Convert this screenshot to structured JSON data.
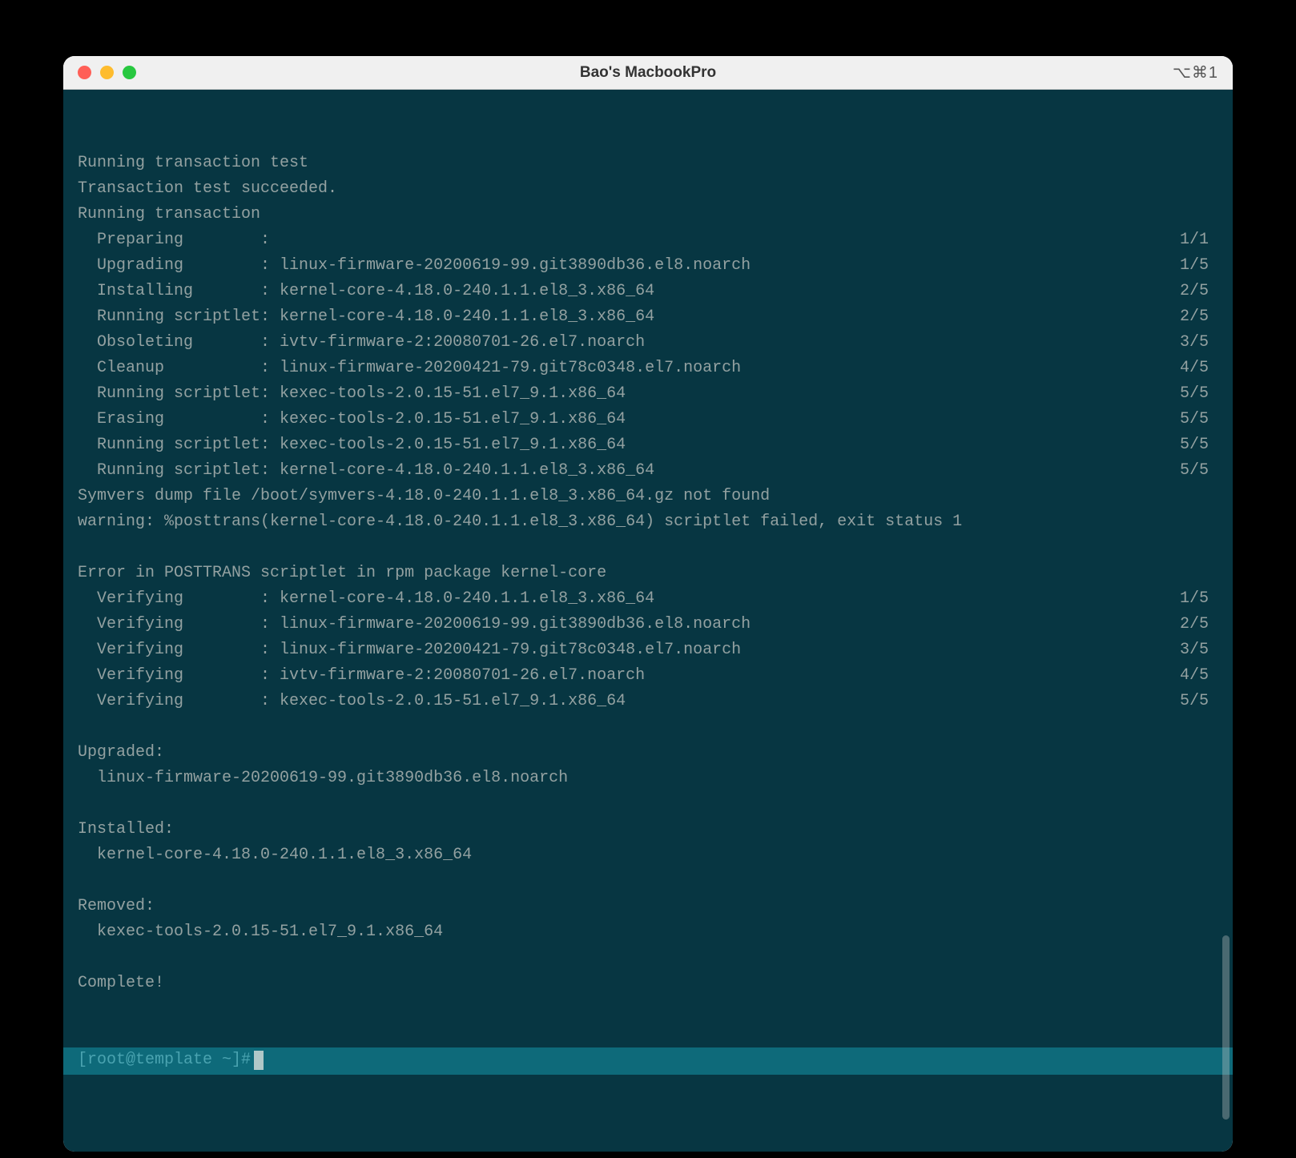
{
  "window": {
    "title": "Bao's MacbookPro",
    "shortcut": "⌥⌘1"
  },
  "terminal": {
    "lines": [
      {
        "left": "Running transaction test",
        "right": ""
      },
      {
        "left": "Transaction test succeeded.",
        "right": ""
      },
      {
        "left": "Running transaction",
        "right": ""
      },
      {
        "left": "  Preparing        :",
        "right": "1/1"
      },
      {
        "left": "  Upgrading        : linux-firmware-20200619-99.git3890db36.el8.noarch",
        "right": "1/5"
      },
      {
        "left": "  Installing       : kernel-core-4.18.0-240.1.1.el8_3.x86_64",
        "right": "2/5"
      },
      {
        "left": "  Running scriptlet: kernel-core-4.18.0-240.1.1.el8_3.x86_64",
        "right": "2/5"
      },
      {
        "left": "  Obsoleting       : ivtv-firmware-2:20080701-26.el7.noarch",
        "right": "3/5"
      },
      {
        "left": "  Cleanup          : linux-firmware-20200421-79.git78c0348.el7.noarch",
        "right": "4/5"
      },
      {
        "left": "  Running scriptlet: kexec-tools-2.0.15-51.el7_9.1.x86_64",
        "right": "5/5"
      },
      {
        "left": "  Erasing          : kexec-tools-2.0.15-51.el7_9.1.x86_64",
        "right": "5/5"
      },
      {
        "left": "  Running scriptlet: kexec-tools-2.0.15-51.el7_9.1.x86_64",
        "right": "5/5"
      },
      {
        "left": "  Running scriptlet: kernel-core-4.18.0-240.1.1.el8_3.x86_64",
        "right": "5/5"
      },
      {
        "left": "Symvers dump file /boot/symvers-4.18.0-240.1.1.el8_3.x86_64.gz not found",
        "right": ""
      },
      {
        "left": "warning: %posttrans(kernel-core-4.18.0-240.1.1.el8_3.x86_64) scriptlet failed, exit status 1",
        "right": ""
      },
      {
        "left": "",
        "right": ""
      },
      {
        "left": "Error in POSTTRANS scriptlet in rpm package kernel-core",
        "right": ""
      },
      {
        "left": "  Verifying        : kernel-core-4.18.0-240.1.1.el8_3.x86_64",
        "right": "1/5"
      },
      {
        "left": "  Verifying        : linux-firmware-20200619-99.git3890db36.el8.noarch",
        "right": "2/5"
      },
      {
        "left": "  Verifying        : linux-firmware-20200421-79.git78c0348.el7.noarch",
        "right": "3/5"
      },
      {
        "left": "  Verifying        : ivtv-firmware-2:20080701-26.el7.noarch",
        "right": "4/5"
      },
      {
        "left": "  Verifying        : kexec-tools-2.0.15-51.el7_9.1.x86_64",
        "right": "5/5"
      },
      {
        "left": "",
        "right": ""
      },
      {
        "left": "Upgraded:",
        "right": ""
      },
      {
        "left": "  linux-firmware-20200619-99.git3890db36.el8.noarch",
        "right": ""
      },
      {
        "left": "",
        "right": ""
      },
      {
        "left": "Installed:",
        "right": ""
      },
      {
        "left": "  kernel-core-4.18.0-240.1.1.el8_3.x86_64",
        "right": ""
      },
      {
        "left": "",
        "right": ""
      },
      {
        "left": "Removed:",
        "right": ""
      },
      {
        "left": "  kexec-tools-2.0.15-51.el7_9.1.x86_64",
        "right": ""
      },
      {
        "left": "",
        "right": ""
      },
      {
        "left": "Complete!",
        "right": ""
      }
    ],
    "prompt": "[root@template ~]#"
  }
}
